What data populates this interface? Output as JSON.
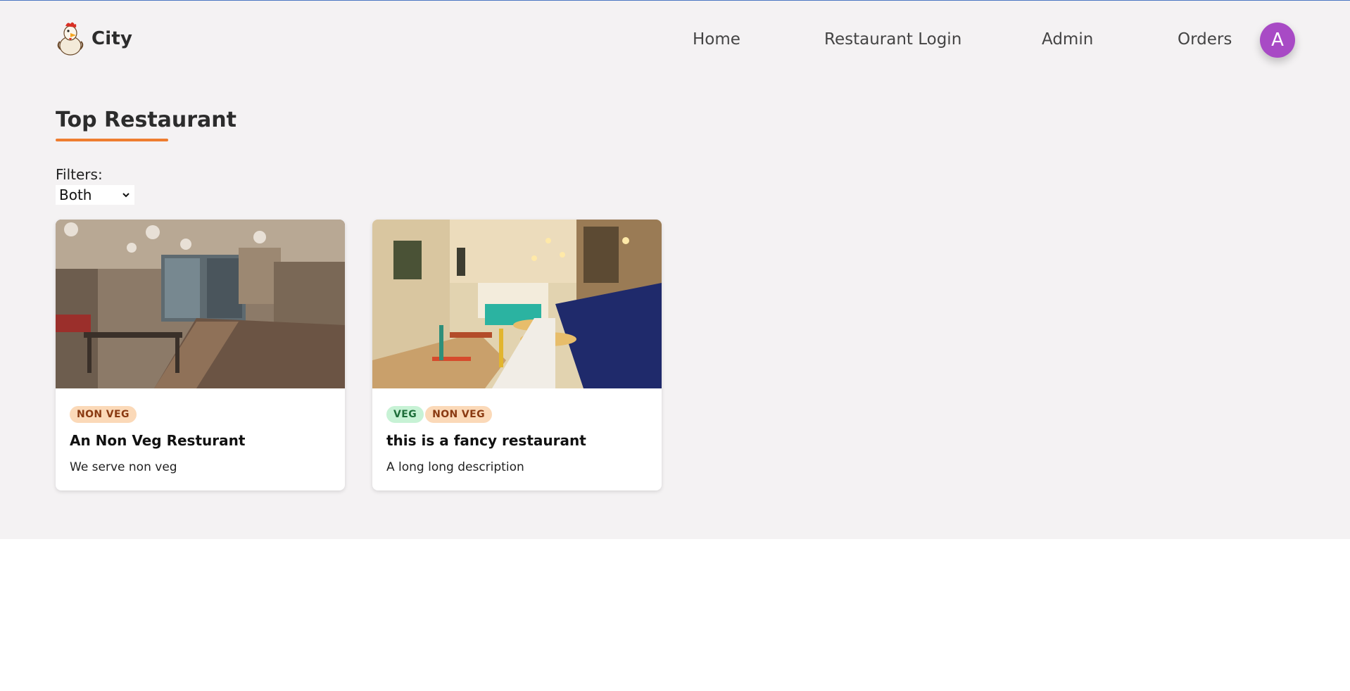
{
  "brand": {
    "name": "City",
    "logo_icon": "rooster-chef-logo"
  },
  "nav": {
    "home": "Home",
    "restaurant_login": "Restaurant Login",
    "admin": "Admin",
    "orders": "Orders",
    "avatar_initial": "A"
  },
  "section": {
    "title": "Top Restaurant"
  },
  "filters": {
    "label": "Filters:",
    "selected": "Both"
  },
  "restaurants": [
    {
      "tags": [
        "NON VEG"
      ],
      "name": "An Non Veg Resturant",
      "description": "We serve non veg",
      "image_icon": "restaurant-interior-photo"
    },
    {
      "tags": [
        "VEG",
        "NON VEG"
      ],
      "name": "this is a fancy restaurant",
      "description": "A long long description",
      "image_icon": "restaurant-interior-photo"
    }
  ],
  "colors": {
    "accent": "#ee7d2f",
    "avatar": "#a84ac5",
    "background": "#f4f2f3",
    "veg_tag": "#c7f2d5",
    "nonveg_tag": "#fbd9b8"
  }
}
